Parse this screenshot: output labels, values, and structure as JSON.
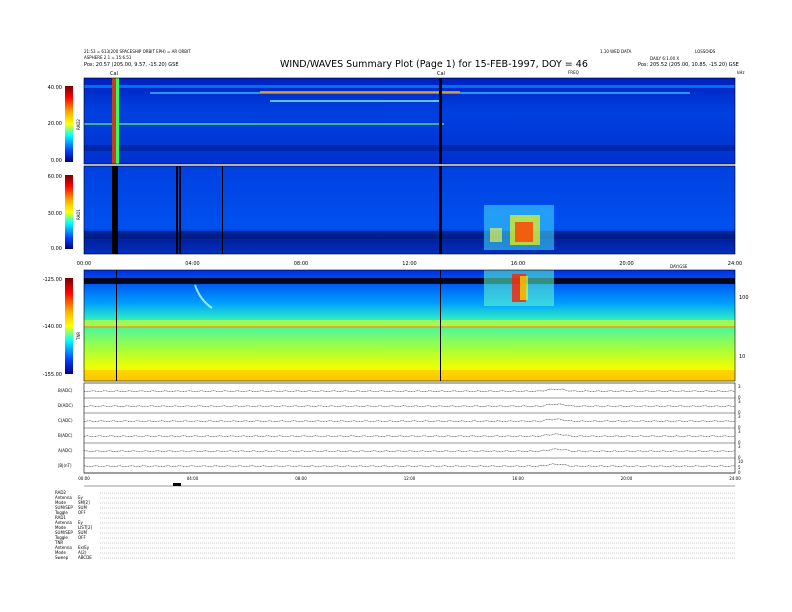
{
  "header": {
    "title": "WIND/WAVES Summary Plot (Page 1) for 15-FEB-1997, DOY = 46",
    "left_line1": "21:53 = 613(200 SPACESHIP ORBIT EPH) = AR ORBIT",
    "left_line2": "ASPHERE 2.1 = 15:6.51",
    "left_line3": "Pos: 20.57 (205.00, 9.57, -15.20) GSE",
    "right_line1": "LOSSOIDS",
    "right_line2": "DAILY 6:1.00 X",
    "right_line3": "Pos: 205.52 (205.00, 10.85, -15.20) GSE",
    "top_center_right": "1.10 WED DATA",
    "cal_label_1": "Cal",
    "cal_label_2": "Cal",
    "rad_unit": "kHz",
    "freq_label": "FREQ"
  },
  "chart_data": [
    {
      "type": "heatmap",
      "name_label": "RAD2",
      "ylim": [
        0,
        40
      ],
      "yticks": [
        "40.00",
        "20.00",
        "0.00"
      ],
      "colorscale": [
        "#7a0000",
        "#ff0000",
        "#ff8000",
        "#ffff00",
        "#00ffff",
        "#0000ff",
        "#000080"
      ]
    },
    {
      "type": "heatmap",
      "name_label": "RAD1",
      "ylim": [
        0,
        60
      ],
      "yticks": [
        "60.00",
        "30.00",
        "0.00"
      ],
      "xticks": [
        "00:00",
        "04:00",
        "08:00",
        "12:00",
        "16:00",
        "20:00",
        "24:00"
      ],
      "xlabel": "DAY/GSE"
    },
    {
      "type": "heatmap",
      "name_label": "TNR",
      "yticks": [
        "-125.00",
        "-140.00",
        "-155.00"
      ],
      "right_ticks": [
        "100",
        "10"
      ]
    },
    {
      "type": "line",
      "rows": [
        {
          "label": "B(ADC)",
          "right": [
            "3",
            "0"
          ]
        },
        {
          "label": "D(ADC)",
          "right": [
            "3",
            "0"
          ]
        },
        {
          "label": "C(ADC)",
          "right": [
            "3",
            "0"
          ]
        },
        {
          "label": "B(ADC)",
          "right": [
            "3",
            "0"
          ]
        },
        {
          "label": "A(ADC)",
          "right": [
            "3",
            "0"
          ]
        },
        {
          "label": "|B|(nT)",
          "right": [
            "10",
            "5",
            "0"
          ]
        }
      ],
      "xticks": [
        "00:00",
        "04:00",
        "08:00",
        "12:00",
        "16:00",
        "20:00",
        "24:00"
      ]
    }
  ],
  "footer": {
    "rows": [
      {
        "k": "RAD2",
        "v": ""
      },
      {
        "k": "Antenna",
        "v": "Ey"
      },
      {
        "k": "Mode",
        "v": "SM[2]"
      },
      {
        "k": "SUM/SEP",
        "v": "SUM"
      },
      {
        "k": "Toggle",
        "v": "OFF"
      },
      {
        "k": "RAD1",
        "v": ""
      },
      {
        "k": "Antenna",
        "v": "Ey"
      },
      {
        "k": "Mode",
        "v": "LIST[2]"
      },
      {
        "k": "SUM/SEP",
        "v": "SUM"
      },
      {
        "k": "Toggle",
        "v": "OFF"
      },
      {
        "k": "TNR",
        "v": ""
      },
      {
        "k": "Antenna",
        "v": "Ex/Ey"
      },
      {
        "k": "Mode",
        "v": "A(2)"
      },
      {
        "k": "Sweep",
        "v": "ABCDE"
      }
    ]
  }
}
